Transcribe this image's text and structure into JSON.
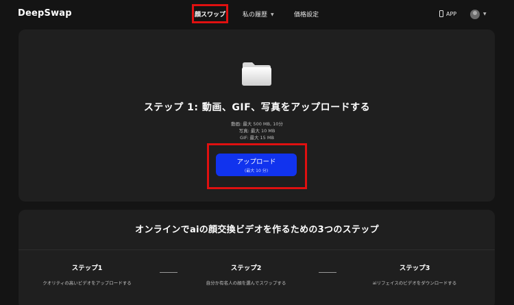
{
  "header": {
    "logo": "DeepSwap",
    "nav": {
      "face_swap": "顔スワップ",
      "history": "私の履歴",
      "pricing": "価格設定"
    },
    "app_label": "APP"
  },
  "upload": {
    "title": "ステップ 1: 動画、GIF、写真をアップロードする",
    "limits": {
      "video": "動画: 最大 500 MB, 10分",
      "photo": "写真: 最大 10 MB",
      "gif": "GIF: 最大 15 MB"
    },
    "button_label": "アップロード",
    "button_sub": "(最大 10 分)"
  },
  "steps": {
    "heading": "オンラインでaiの顔交換ビデオを作るための3つのステップ",
    "items": [
      {
        "name": "ステップ1",
        "desc": "クオリティの高いビデオをアップロードする"
      },
      {
        "name": "ステップ2",
        "desc": "自分か有名人の顔を選んでスワップする"
      },
      {
        "name": "ステップ3",
        "desc": "aiリフェイスのビデオをダウンロードする"
      }
    ]
  },
  "colors": {
    "background": "#141414",
    "card": "#1f1f1f",
    "accent": "#1133ee",
    "highlight": "#e01010"
  }
}
